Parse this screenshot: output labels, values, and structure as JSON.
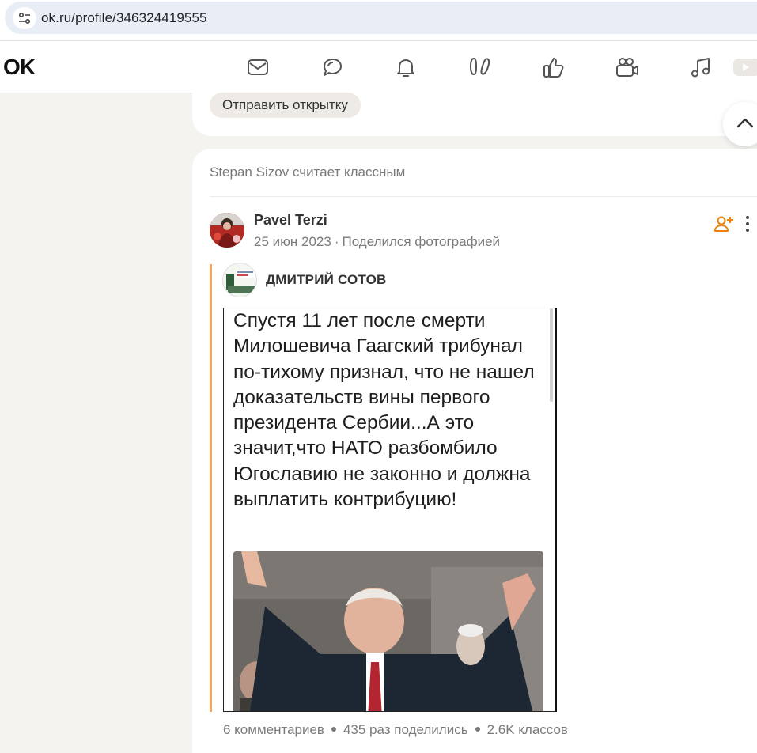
{
  "browser": {
    "url": "ok.ru/profile/346324419555"
  },
  "topnav": {
    "logo": "OK",
    "icons": [
      "mail-icon",
      "chat-icon",
      "bell-icon",
      "guests-icon",
      "like-icon",
      "video-icon",
      "music-icon",
      "play-icon"
    ]
  },
  "card_top": {
    "send_postcard": "Отправить открытку"
  },
  "post": {
    "activity": "Stepan Sizov считает классным",
    "author": "Pavel Terzi",
    "date": "25 июн 2023",
    "meta_sep": "·",
    "action": "Поделился фотографией",
    "repost_author": "ДМИТРИЙ СОТОВ",
    "photo_text": "Спустя 11 лет после смерти Милошевича Гаагский трибунал по-тихому признал, что не нашел доказательств вины первого президента Сербии...А это значит,что НАТО разбомбило Югославию не законно и должна выплатить контрибуцию!",
    "stats": {
      "comments": "6 комментариев",
      "shares": "435 раз поделились",
      "likes": "2.6K классов"
    }
  },
  "colors": {
    "accent": "#f4a55a",
    "ok_orange": "#ee8208",
    "page_bg": "#f5f3f0"
  }
}
